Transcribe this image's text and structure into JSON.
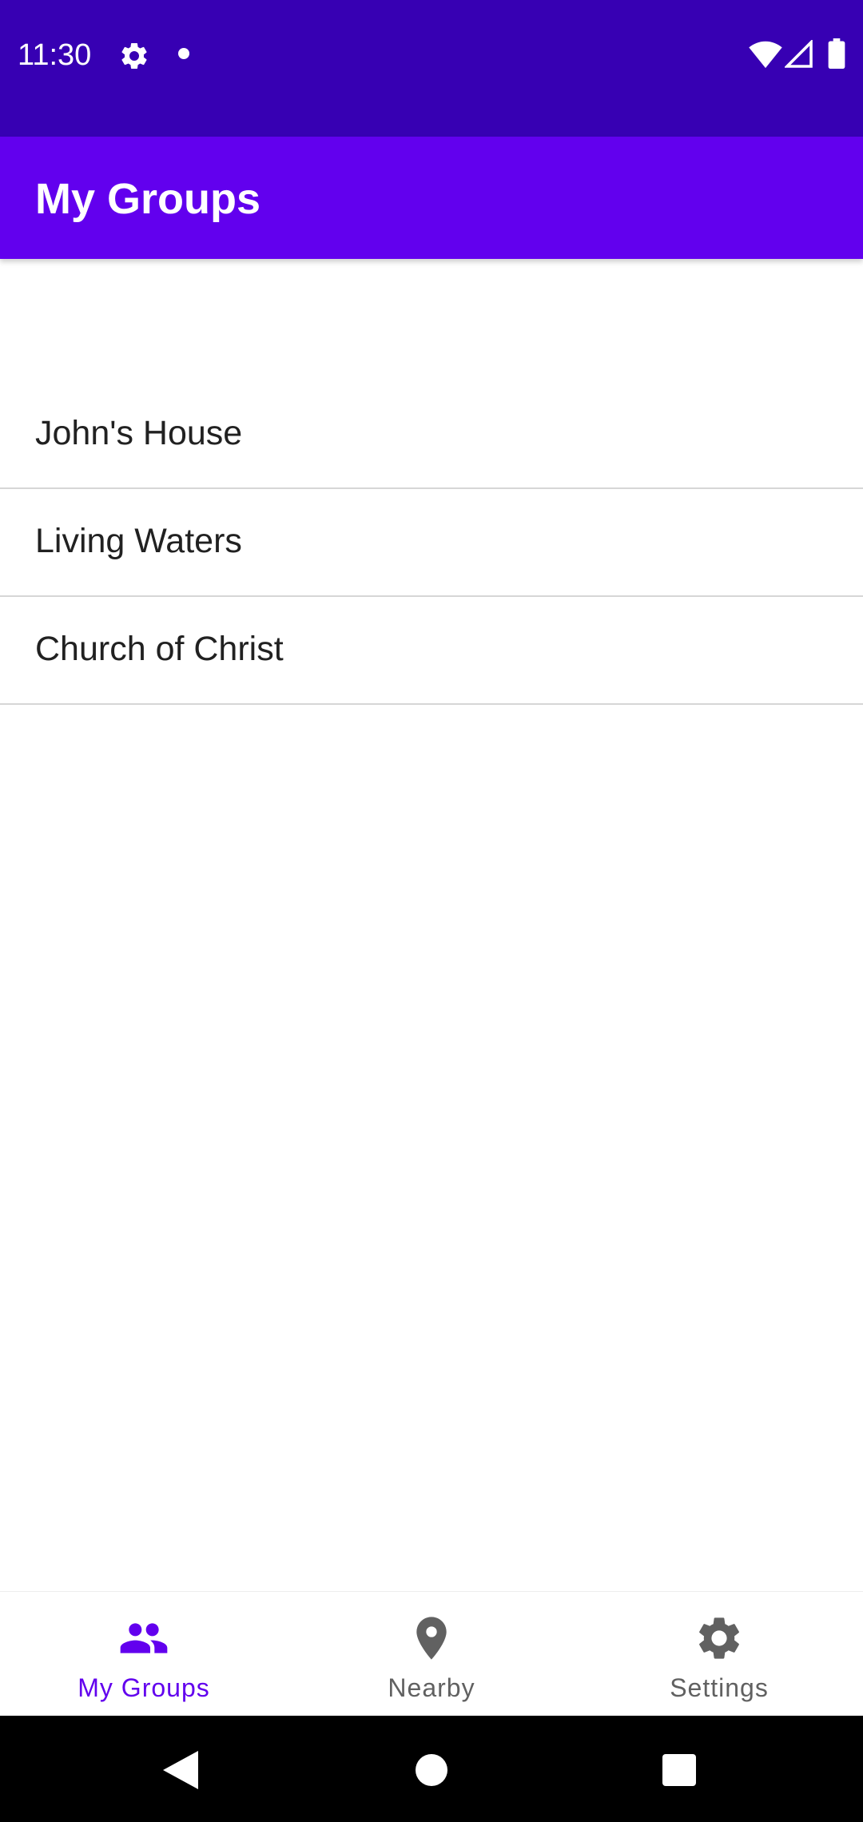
{
  "status_bar": {
    "time": "11:30",
    "background_color": "#3700b3",
    "icons": [
      "gear-icon",
      "notification-dot-icon",
      "wifi-icon",
      "cell-signal-icon",
      "battery-icon"
    ]
  },
  "app_bar": {
    "title": "My Groups",
    "background_color": "#6200ee"
  },
  "groups": [
    {
      "label": "John's House"
    },
    {
      "label": "Living Waters"
    },
    {
      "label": "Church of Christ"
    }
  ],
  "bottom_nav": {
    "active_color": "#6200ee",
    "inactive_color": "#616161",
    "tabs": [
      {
        "label": "My Groups",
        "icon": "people-icon",
        "active": true
      },
      {
        "label": "Nearby",
        "icon": "location-pin-icon",
        "active": false
      },
      {
        "label": "Settings",
        "icon": "gear-icon",
        "active": false
      }
    ]
  },
  "system_nav": {
    "buttons": [
      "back-icon",
      "home-icon",
      "recents-icon"
    ]
  }
}
